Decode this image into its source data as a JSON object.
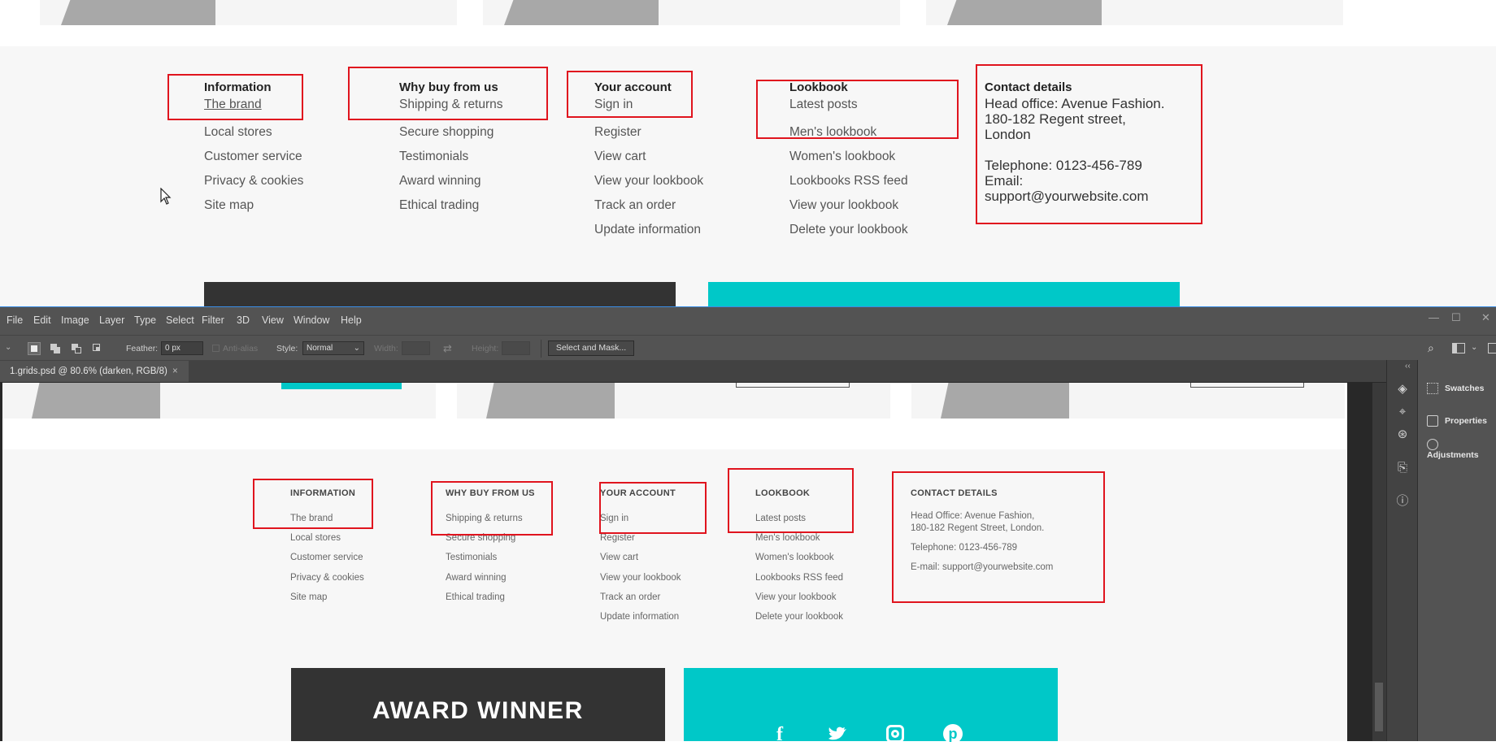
{
  "top_footer": {
    "information": {
      "title": "Information",
      "links": [
        "The brand",
        "Local stores",
        "Customer service",
        "Privacy & cookies",
        "Site map"
      ]
    },
    "why_buy": {
      "title": "Why buy from us",
      "links": [
        "Shipping & returns",
        "Secure shopping",
        "Testimonials",
        "Award winning",
        "Ethical trading"
      ]
    },
    "your_account": {
      "title": "Your account",
      "links": [
        "Sign in",
        "Register",
        "View cart",
        "View your lookbook",
        "Track an order",
        "Update information"
      ]
    },
    "lookbook": {
      "title": "Lookbook",
      "links": [
        "Latest posts",
        "Men's lookbook",
        "Women's lookbook",
        "Lookbooks RSS feed",
        "View your lookbook",
        "Delete your lookbook"
      ]
    },
    "contact": {
      "title": "Contact details",
      "line1": "Head office: Avenue Fashion.",
      "line2": "180-182 Regent street,",
      "line3": "London",
      "telephone": "Telephone: 0123-456-789",
      "email_label": "Email:",
      "email": "support@yourwebsite.com"
    }
  },
  "photoshop": {
    "menu": [
      "File",
      "Edit",
      "Image",
      "Layer",
      "Type",
      "Select",
      "Filter",
      "3D",
      "View",
      "Window",
      "Help"
    ],
    "options": {
      "feather_label": "Feather:",
      "feather_value": "0 px",
      "antialias_label": "Anti-alias",
      "style_label": "Style:",
      "style_value": "Normal",
      "width_label": "Width:",
      "height_label": "Height:",
      "select_mask_label": "Select and Mask..."
    },
    "doc_tab": "1.grids.psd @ 80.6% (darken, RGB/8)",
    "doc_tab_close": "×",
    "panels": {
      "swatches": "Swatches",
      "properties": "Properties",
      "adjustments": "Adjustments"
    },
    "canvas_footer": {
      "information": {
        "title": "INFORMATION",
        "links": [
          "The brand",
          "Local stores",
          "Customer service",
          "Privacy & cookies",
          "Site map"
        ]
      },
      "why_buy": {
        "title": "WHY BUY FROM US",
        "links": [
          "Shipping & returns",
          "Secure shopping",
          "Testimonials",
          "Award winning",
          "Ethical trading"
        ]
      },
      "your_account": {
        "title": "YOUR ACCOUNT",
        "links": [
          "Sign in",
          "Register",
          "View cart",
          "View your lookbook",
          "Track an order",
          "Update information"
        ]
      },
      "lookbook": {
        "title": "LOOKBOOK",
        "links": [
          "Latest posts",
          "Men's lookbook",
          "Women's lookbook",
          "Lookbooks RSS feed",
          "View your lookbook",
          "Delete your lookbook"
        ]
      },
      "contact": {
        "title": "CONTACT DETAILS",
        "line1": "Head Office: Avenue Fashion,",
        "line2": "180-182 Regent Street, London.",
        "telephone": "Telephone: 0123-456-789",
        "email": "E-mail: support@yourwebsite.com"
      }
    },
    "award_text": "AWARD WINNER",
    "social": [
      "f",
      "t",
      "◎",
      "p"
    ]
  },
  "colors": {
    "highlight_box": "#e0141e",
    "teal": "#00c8c8",
    "dark_block": "#333333"
  }
}
